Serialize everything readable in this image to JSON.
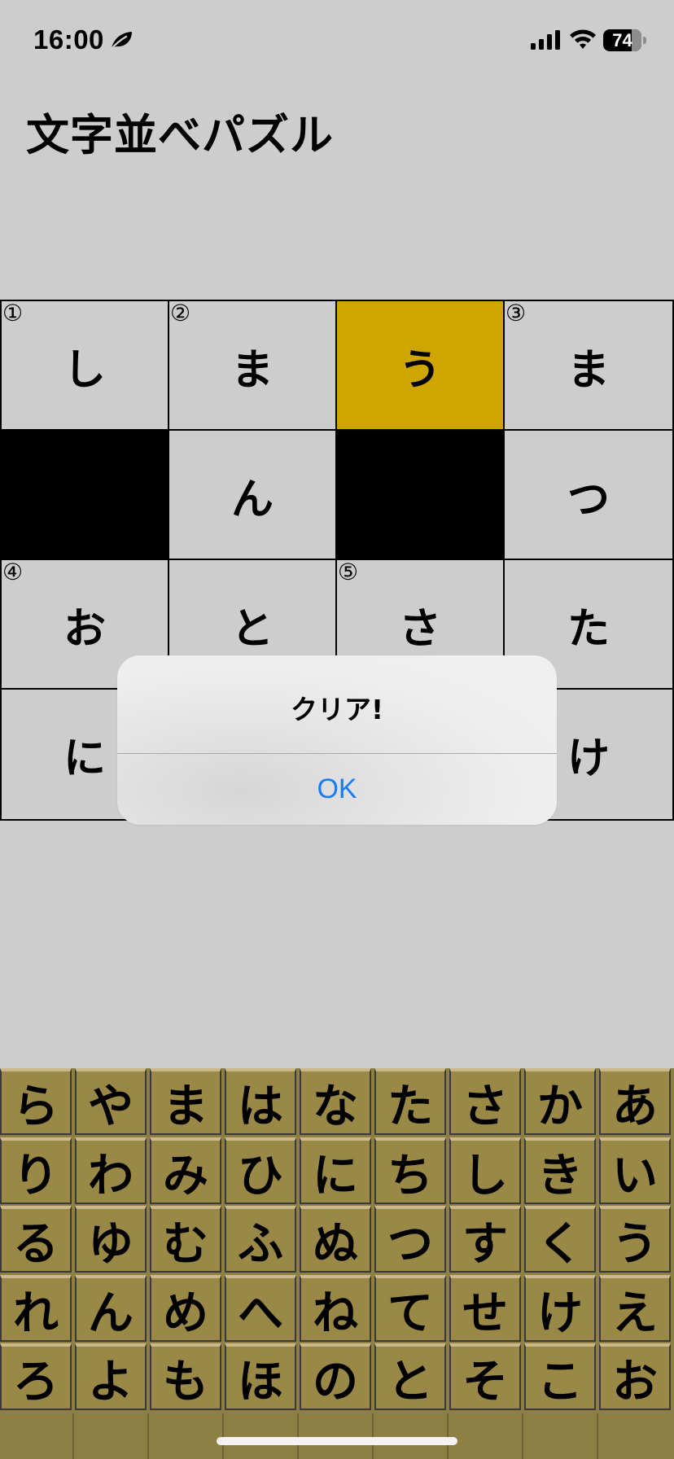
{
  "status_bar": {
    "time": "16:00",
    "battery": "74"
  },
  "title": "文字並べパズル",
  "grid": {
    "rows": [
      [
        {
          "num": "①",
          "char": "し",
          "state": "normal"
        },
        {
          "num": "②",
          "char": "ま",
          "state": "normal"
        },
        {
          "num": "",
          "char": "う",
          "state": "highlight"
        },
        {
          "num": "③",
          "char": "ま",
          "state": "normal"
        }
      ],
      [
        {
          "num": "",
          "char": "",
          "state": "blocked"
        },
        {
          "num": "",
          "char": "ん",
          "state": "normal"
        },
        {
          "num": "",
          "char": "",
          "state": "blocked"
        },
        {
          "num": "",
          "char": "つ",
          "state": "normal"
        }
      ],
      [
        {
          "num": "④",
          "char": "お",
          "state": "normal"
        },
        {
          "num": "",
          "char": "と",
          "state": "normal"
        },
        {
          "num": "⑤",
          "char": "さ",
          "state": "normal"
        },
        {
          "num": "",
          "char": "た",
          "state": "normal"
        }
      ],
      [
        {
          "num": "",
          "char": "に",
          "state": "normal"
        },
        {
          "num": "",
          "char": "",
          "state": "normal"
        },
        {
          "num": "",
          "char": "",
          "state": "normal"
        },
        {
          "num": "",
          "char": "け",
          "state": "normal"
        }
      ]
    ]
  },
  "alert": {
    "title": "クリア!",
    "ok_label": "OK"
  },
  "keyboard": {
    "rows": [
      [
        "ら",
        "や",
        "ま",
        "は",
        "な",
        "た",
        "さ",
        "か",
        "あ"
      ],
      [
        "り",
        "わ",
        "み",
        "ひ",
        "に",
        "ち",
        "し",
        "き",
        "い"
      ],
      [
        "る",
        "ゆ",
        "む",
        "ふ",
        "ぬ",
        "つ",
        "す",
        "く",
        "う"
      ],
      [
        "れ",
        "ん",
        "め",
        "へ",
        "ね",
        "て",
        "せ",
        "け",
        "え"
      ],
      [
        "ろ",
        "よ",
        "も",
        "ほ",
        "の",
        "と",
        "そ",
        "こ",
        "お"
      ]
    ]
  },
  "colors": {
    "background": "#cdcdcd",
    "highlight_cell": "#cfa600",
    "blocked_cell": "#000000",
    "key_background": "#9a8847",
    "alert_button": "#1a7cf5"
  },
  "icons": [
    "leaf-icon",
    "signal-icon",
    "wifi-icon",
    "battery-icon"
  ]
}
